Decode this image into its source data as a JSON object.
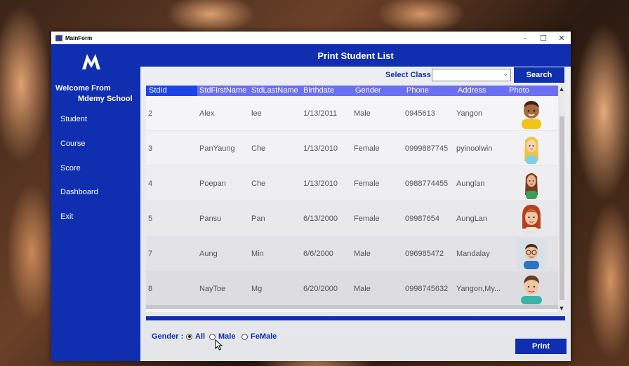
{
  "window": {
    "title": "MainForm",
    "minimize": "–",
    "maximize": "☐",
    "close": "✕"
  },
  "sidebar": {
    "logo_letter": "M",
    "welcome_line1": "Welcome From",
    "welcome_line2": "Mdemy School",
    "items": [
      {
        "label": "Student"
      },
      {
        "label": "Course"
      },
      {
        "label": "Score"
      },
      {
        "label": "Dashboard"
      },
      {
        "label": "Exit"
      }
    ]
  },
  "page_title": "Print Student List",
  "filter": {
    "select_label": "Select Class :",
    "select_value": "",
    "search_label": "Search"
  },
  "table": {
    "columns": [
      "StdId",
      "StdFirstName",
      "StdLastName",
      "Birthdate",
      "Gender",
      "Phone",
      "Address",
      "Photo"
    ],
    "rows": [
      {
        "id": "2",
        "first": "Alex",
        "last": "lee",
        "birthdate": "1/13/2011",
        "gender": "Male",
        "phone": "0945613",
        "address": "Yangon",
        "photo": "boy-curly-hair-avatar"
      },
      {
        "id": "3",
        "first": "PanYaung",
        "last": "Che",
        "birthdate": "1/13/2010",
        "gender": "Female",
        "phone": "0999887745",
        "address": "pyinoolwin",
        "photo": "girl-blonde-avatar"
      },
      {
        "id": "4",
        "first": "Poepan",
        "last": "Che",
        "birthdate": "1/13/2010",
        "gender": "Female",
        "phone": "0988774455",
        "address": "Aunglan",
        "photo": "girl-green-shirt-avatar"
      },
      {
        "id": "5",
        "first": "Pansu",
        "last": "Pan",
        "birthdate": "6/13/2000",
        "gender": "Female",
        "phone": "09987654",
        "address": "AungLan",
        "photo": "woman-red-hair-avatar"
      },
      {
        "id": "7",
        "first": "Aung",
        "last": "Min",
        "birthdate": "6/6/2000",
        "gender": "Male",
        "phone": "096985472",
        "address": "Mandalay",
        "photo": "boy-glasses-avatar"
      },
      {
        "id": "8",
        "first": "NayToe",
        "last": "Mg",
        "birthdate": "6/20/2000",
        "gender": "Male",
        "phone": "0998745632",
        "address": "Yangon,My...",
        "photo": "man-teal-shirt-avatar"
      }
    ]
  },
  "gender_filter": {
    "label": "Gender :",
    "options": [
      {
        "label": "All",
        "checked": true
      },
      {
        "label": "Male",
        "checked": false
      },
      {
        "label": "FeMale",
        "checked": false
      }
    ]
  },
  "print_label": "Print",
  "colors": {
    "primary": "#0f2fb0",
    "header": "#6b6ff2",
    "header_selected": "#1c45e8"
  }
}
